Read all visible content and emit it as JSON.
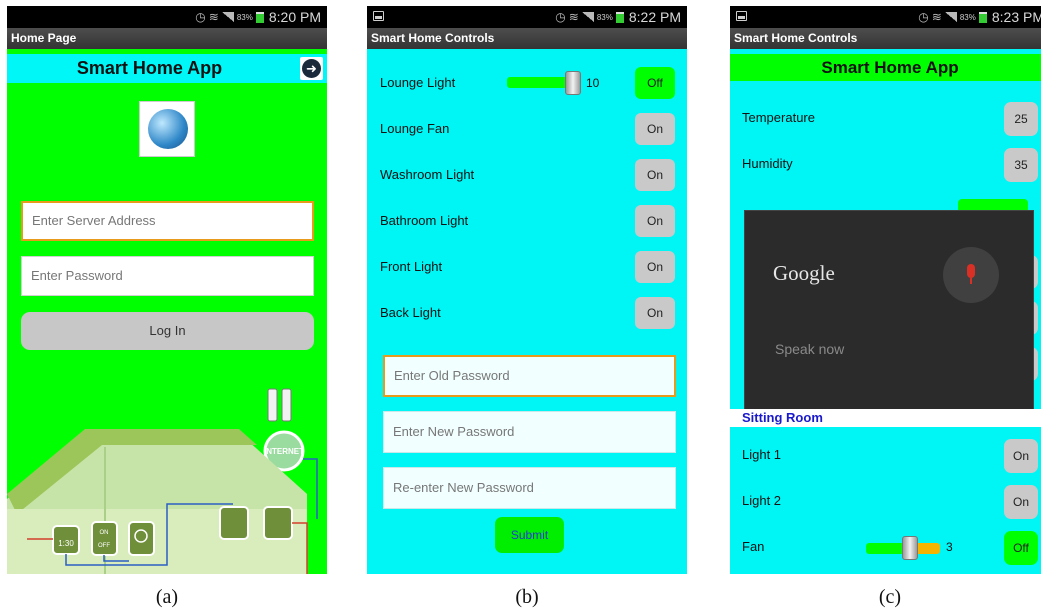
{
  "panels": {
    "a": {
      "caption": "(a)",
      "status": {
        "battery": "83%",
        "time": "8:20 PM"
      },
      "titlebar": "Home Page",
      "header_title": "Smart Home App",
      "server_placeholder": "Enter Server Address",
      "password_placeholder": "Enter Password",
      "login_label": "Log In",
      "scene_labels": {
        "internet": "INTERNET",
        "clock": "1:30",
        "on": "ON",
        "off": "OFF"
      }
    },
    "b": {
      "caption": "(b)",
      "status": {
        "battery": "83%",
        "time": "8:22 PM"
      },
      "titlebar": "Smart Home Controls",
      "lounge_light": {
        "label": "Lounge Light",
        "value": "10",
        "button": "Off"
      },
      "controls": [
        {
          "label": "Lounge Fan",
          "button": "On"
        },
        {
          "label": "Washroom Light",
          "button": "On"
        },
        {
          "label": "Bathroom Light",
          "button": "On"
        },
        {
          "label": "Front Light",
          "button": "On"
        },
        {
          "label": "Back Light",
          "button": "On"
        }
      ],
      "old_password_placeholder": "Enter Old Password",
      "new_password_placeholder": "Enter New Password",
      "reenter_password_placeholder": "Re-enter New Password",
      "submit_label": "Submit"
    },
    "c": {
      "caption": "(c)",
      "status": {
        "battery": "83%",
        "time": "8:23 PM"
      },
      "titlebar": "Smart Home Controls",
      "header_title": "Smart Home App",
      "sensors": [
        {
          "label": "Temperature",
          "value": "25"
        },
        {
          "label": "Humidity",
          "value": "35"
        }
      ],
      "voice_dialog": {
        "brand": "Google",
        "prompt": "Speak now"
      },
      "section_title": "Sitting Room",
      "sitting_room": [
        {
          "label": "Light 1",
          "button": "On"
        },
        {
          "label": "Light 2",
          "button": "On"
        }
      ],
      "fan": {
        "label": "Fan",
        "value": "3",
        "button": "Off"
      }
    }
  },
  "colors": {
    "green": "#00ff00",
    "cyan": "#00f5f5",
    "orange_focus": "#e89a1c",
    "section_blue": "#1a1acc"
  },
  "icons": [
    "notification-icon",
    "alarm-icon",
    "wifi-icon",
    "signal-icon",
    "battery-icon",
    "forward-arrow-icon",
    "globe-logo-icon",
    "microphone-icon"
  ]
}
